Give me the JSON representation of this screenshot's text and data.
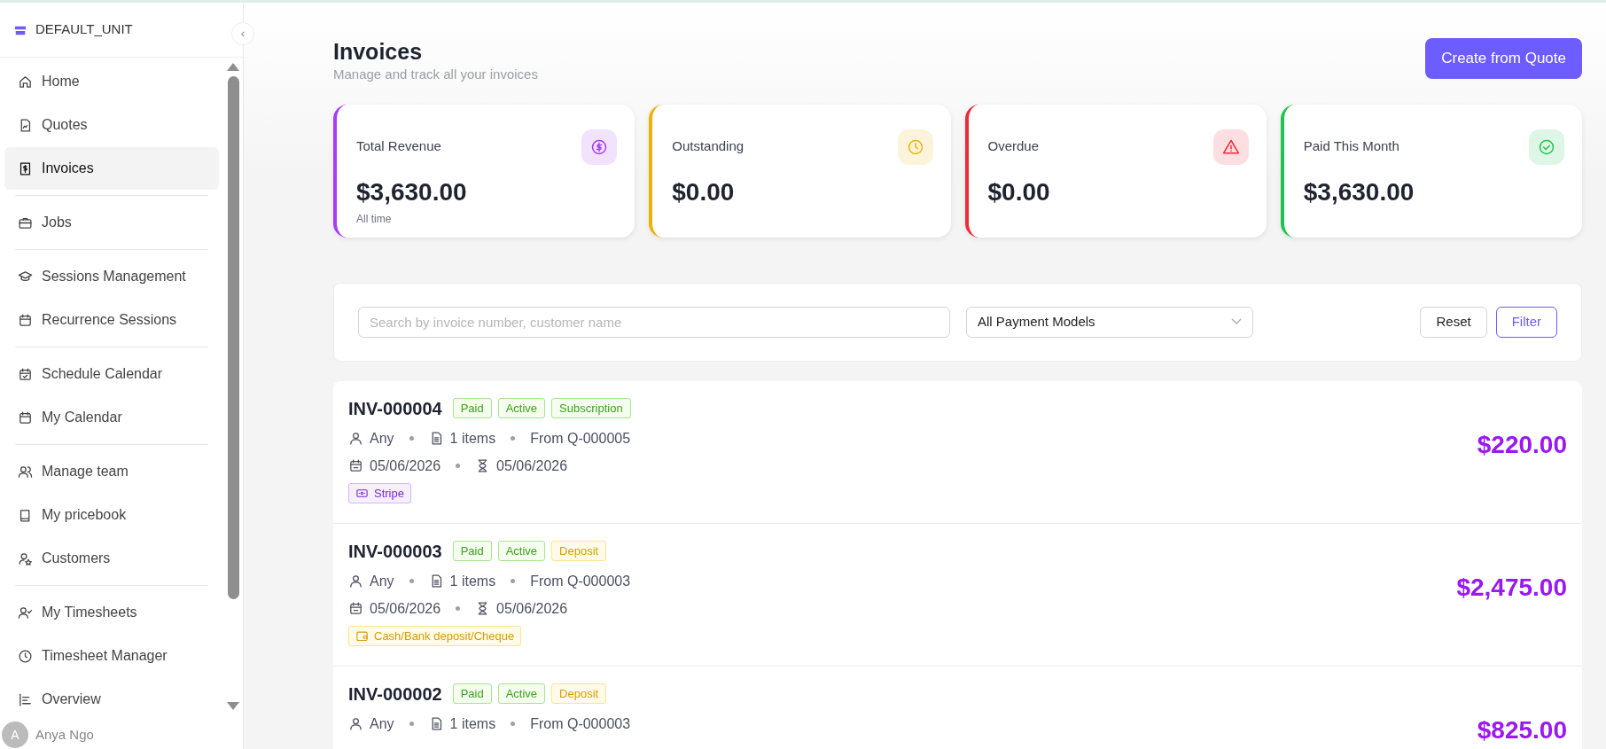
{
  "sidebar": {
    "unit": "DEFAULT_UNIT",
    "groups": [
      [
        {
          "label": "Home",
          "selected": false
        },
        {
          "label": "Quotes",
          "selected": false
        },
        {
          "label": "Invoices",
          "selected": true
        }
      ],
      [
        {
          "label": "Jobs",
          "selected": false
        }
      ],
      [
        {
          "label": "Sessions Management",
          "selected": false
        },
        {
          "label": "Recurrence Sessions",
          "selected": false
        }
      ],
      [
        {
          "label": "Schedule Calendar",
          "selected": false
        },
        {
          "label": "My Calendar",
          "selected": false
        }
      ],
      [
        {
          "label": "Manage team",
          "selected": false
        },
        {
          "label": "My pricebook",
          "selected": false
        },
        {
          "label": "Customers",
          "selected": false
        }
      ],
      [
        {
          "label": "My Timesheets",
          "selected": false
        },
        {
          "label": "Timesheet Manager",
          "selected": false
        },
        {
          "label": "Overview",
          "selected": false
        }
      ]
    ],
    "user": {
      "initial": "A",
      "name": "Anya Ngo"
    }
  },
  "header": {
    "title": "Invoices",
    "subtitle": "Manage and track all your invoices",
    "button": "Create from Quote"
  },
  "stats": [
    {
      "label": "Total Revenue",
      "value": "$3,630.00",
      "note": "All time",
      "color": "#a43df5"
    },
    {
      "label": "Outstanding",
      "value": "$0.00",
      "color": "#eab308"
    },
    {
      "label": "Overdue",
      "value": "$0.00",
      "color": "#ef2b36"
    },
    {
      "label": "Paid This Month",
      "value": "$3,630.00",
      "color": "#1fc450"
    }
  ],
  "filters": {
    "search": {
      "placeholder": "Search by invoice number, customer name"
    },
    "payment_model": "All Payment Models",
    "reset": "Reset",
    "filter": "Filter"
  },
  "invoices": [
    {
      "number": "INV-000004",
      "tags": [
        {
          "label": "Paid",
          "kind": "green"
        },
        {
          "label": "Active",
          "kind": "green"
        },
        {
          "label": "Subscription",
          "kind": "green"
        }
      ],
      "customer": "Any",
      "items": "1 items",
      "source": "From Q-000005",
      "issued": "05/06/2026",
      "due": "05/06/2026",
      "payment": {
        "label": "Stripe",
        "kind": "card"
      },
      "amount": "$220.00"
    },
    {
      "number": "INV-000003",
      "tags": [
        {
          "label": "Paid",
          "kind": "green"
        },
        {
          "label": "Active",
          "kind": "green"
        },
        {
          "label": "Deposit",
          "kind": "yellow"
        }
      ],
      "customer": "Any",
      "items": "1 items",
      "source": "From Q-000003",
      "issued": "05/06/2026",
      "due": "05/06/2026",
      "payment": {
        "label": "Cash/Bank deposit/Cheque",
        "kind": "wallet"
      },
      "amount": "$2,475.00"
    },
    {
      "number": "INV-000002",
      "tags": [
        {
          "label": "Paid",
          "kind": "green"
        },
        {
          "label": "Active",
          "kind": "green"
        },
        {
          "label": "Deposit",
          "kind": "yellow"
        }
      ],
      "customer": "Any",
      "items": "1 items",
      "source": "From Q-000003",
      "amount": "$825.00"
    }
  ]
}
